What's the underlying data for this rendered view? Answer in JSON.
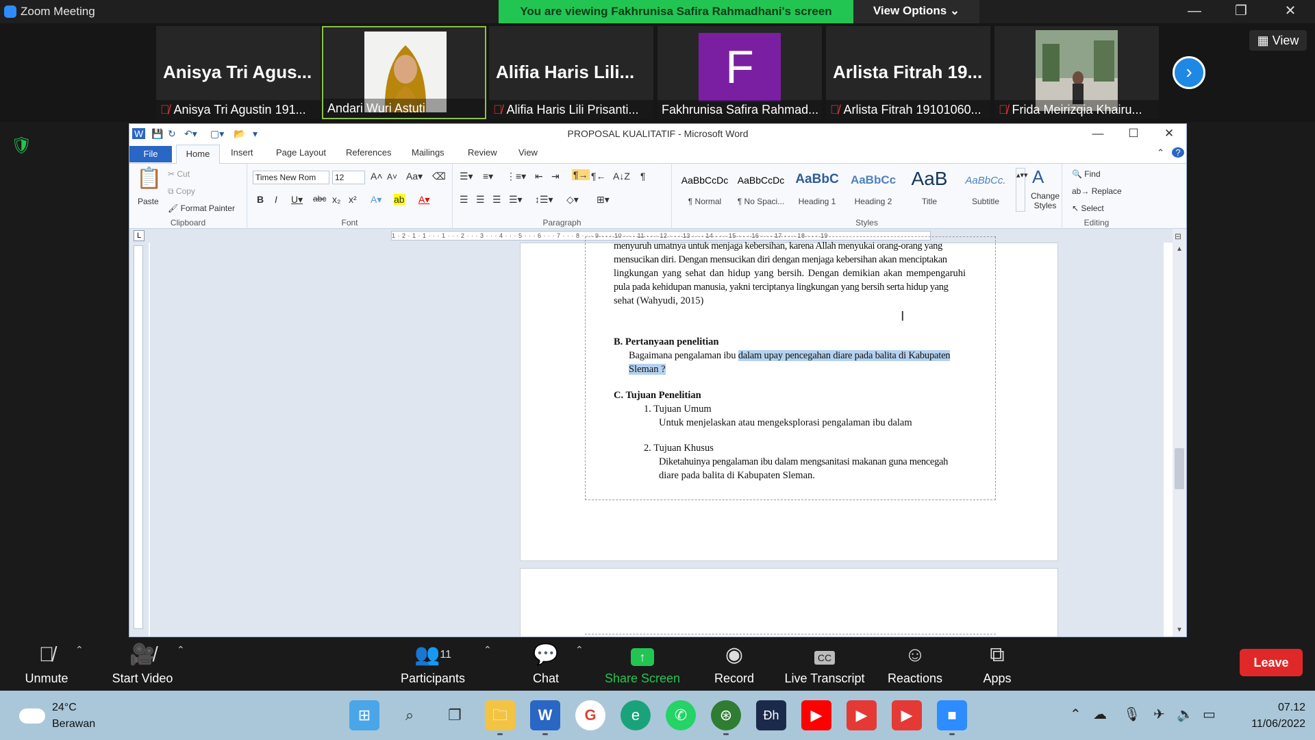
{
  "zoom": {
    "app_title": "Zoom Meeting",
    "banner": "You are viewing Fakhrunisa Safira Rahmadhani's screen",
    "view_options": "View Options ⌄",
    "view_button": "View",
    "controls": {
      "minimize": "—",
      "restore": "❐",
      "close": "✕"
    }
  },
  "gallery": [
    {
      "big_name": "Anisya  Tri  Agus...",
      "caption": "Anisya Tri Agustin 191...",
      "muted": true
    },
    {
      "big_name": "",
      "caption": "Andari Wuri Astuti",
      "muted": false,
      "active": true
    },
    {
      "big_name": "Alifia Haris Lili...",
      "caption": "Alifia Haris Lili Prisanti...",
      "muted": true
    },
    {
      "big_name": "",
      "caption": "Fakhrunisa Safira Rahmad...",
      "muted": false,
      "avatar_letter": "F"
    },
    {
      "big_name": "Arlista  Fitrah  19...",
      "caption": "Arlista Fitrah 19101060...",
      "muted": true
    },
    {
      "big_name": "",
      "caption": "Frida Meirizqia Khairu...",
      "muted": true
    }
  ],
  "word": {
    "title": "PROPOSAL KUALITATIF  -  Microsoft Word",
    "tabs": [
      "File",
      "Home",
      "Insert",
      "Page Layout",
      "References",
      "Mailings",
      "Review",
      "View"
    ],
    "clipboard": {
      "paste": "Paste",
      "cut": "Cut",
      "copy": "Copy",
      "format_painter": "Format Painter",
      "label": "Clipboard"
    },
    "font": {
      "name": "Times New Rom",
      "size": "12",
      "label": "Font"
    },
    "paragraph_label": "Paragraph",
    "styles": [
      {
        "preview": "AaBbCcDc",
        "name": "¶ Normal",
        "color": "#222222"
      },
      {
        "preview": "AaBbCcDc",
        "name": "¶ No Spaci...",
        "color": "#222222"
      },
      {
        "preview": "AaBbC",
        "name": "Heading 1",
        "color": "#2e5c9a"
      },
      {
        "preview": "AaBbCc",
        "name": "Heading 2",
        "color": "#4f81bd"
      },
      {
        "preview": "AaB",
        "name": "Title",
        "color": "#17365d"
      },
      {
        "preview": "AaBbCc.",
        "name": "Subtitle",
        "color": "#4f81bd"
      }
    ],
    "styles_label": "Styles",
    "change_styles": "Change Styles",
    "editing": {
      "find": "Find",
      "replace": "Replace",
      "select": "Select",
      "label": "Editing"
    },
    "ruler": "1 · 2 · 1 · 1 · · · 1 · · · 2 · · · 3 · · · 4 · · · 5 · · · 6 · · · 7 · · · 8 · · · 9 · · · 10 · · · 11 · · · 12 · · · 13 · · · 14 · · · 15 · · · 16 · · · 17 · · · 18 · · · 19"
  },
  "document": {
    "para_lines": [
      "menyuruh umatnya untuk menjaga kebersihan, karena Allah menyukai orang-orang yang",
      "mensucikan diri. Dengan mensucikan diri dengan menjaga kebersihan akan menciptakan",
      "lingkungan yang sehat dan hidup yang bersih. Dengan demikian akan mempengaruhi",
      "pula pada kehidupan manusia, yakni terciptanya lingkungan yang bersih serta hidup yang",
      "sehat (Wahyudi, 2015)"
    ],
    "section_b_heading": "B.   Pertanyaan penelitian",
    "section_b_text_plain": "Bagaimana pengalaman ibu ",
    "section_b_text_selected": "dalam upay pencegahan diare pada balita di Kabupaten",
    "section_b_line2": "Sleman ? ",
    "section_c_heading": "C.   Tujuan Penelitian",
    "item1_title": "1.    Tujuan Umum",
    "item1_text": "Untuk menjelaskan atau mengeksplorasi pengalaman ibu dalam",
    "item2_title": "2.    Tujuan Khusus",
    "item2_text1": "Diketahuinya pengalaman ibu dalam mengsanitasi  makanan guna mencegah",
    "item2_text2": "diare pada balita di Kabupaten Sleman."
  },
  "toolbar": {
    "unmute": "Unmute",
    "start_video": "Start Video",
    "participants": "Participants",
    "participants_count": "11",
    "chat": "Chat",
    "share_screen": "Share Screen",
    "record": "Record",
    "live_transcript": "Live Transcript",
    "reactions": "Reactions",
    "apps": "Apps",
    "leave": "Leave"
  },
  "taskbar": {
    "temperature": "24°C",
    "weather": "Berawan",
    "time": "07.12",
    "date": "11/06/2022"
  },
  "colors": {
    "zoom_green": "#23c552",
    "leave_red": "#e02828",
    "selection": "#b4d2f0",
    "word_blue": "#2a66c3"
  }
}
